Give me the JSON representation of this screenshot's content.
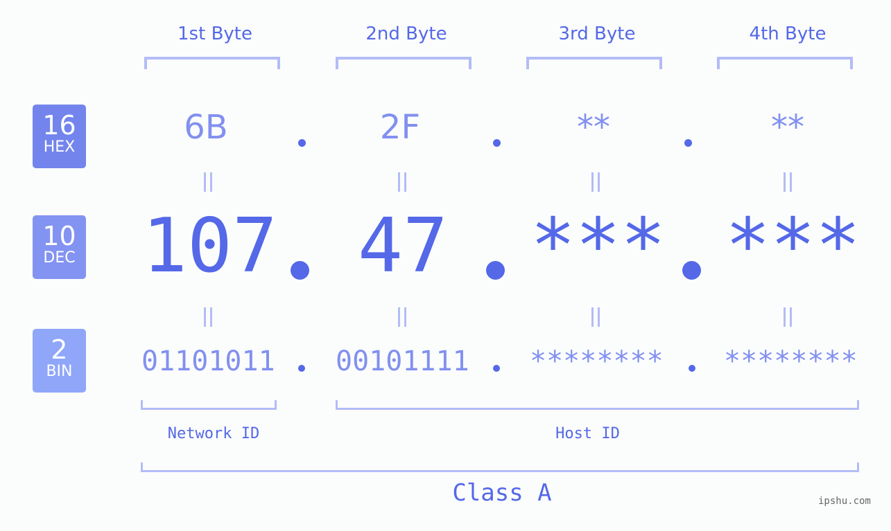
{
  "bytes": [
    {
      "label": "1st Byte",
      "hex": "6B",
      "dec": "107",
      "bin": "01101011"
    },
    {
      "label": "2nd Byte",
      "hex": "2F",
      "dec": "47",
      "bin": "00101111"
    },
    {
      "label": "3rd Byte",
      "hex": "**",
      "dec": "***",
      "bin": "********"
    },
    {
      "label": "4th Byte",
      "hex": "**",
      "dec": "***",
      "bin": "********"
    }
  ],
  "badges": {
    "hex": {
      "num": "16",
      "label": "HEX",
      "color": "#7385ec"
    },
    "dec": {
      "num": "10",
      "label": "DEC",
      "color": "#8393f1"
    },
    "bin": {
      "num": "2",
      "label": "BIN",
      "color": "#8fa6f9"
    }
  },
  "labels": {
    "network_id": "Network ID",
    "host_id": "Host ID",
    "class": "Class A",
    "watermark": "ipshu.com"
  },
  "colors": {
    "primary": "#5468e8",
    "light": "#8190ef",
    "bracket": "#b3bcf6"
  }
}
